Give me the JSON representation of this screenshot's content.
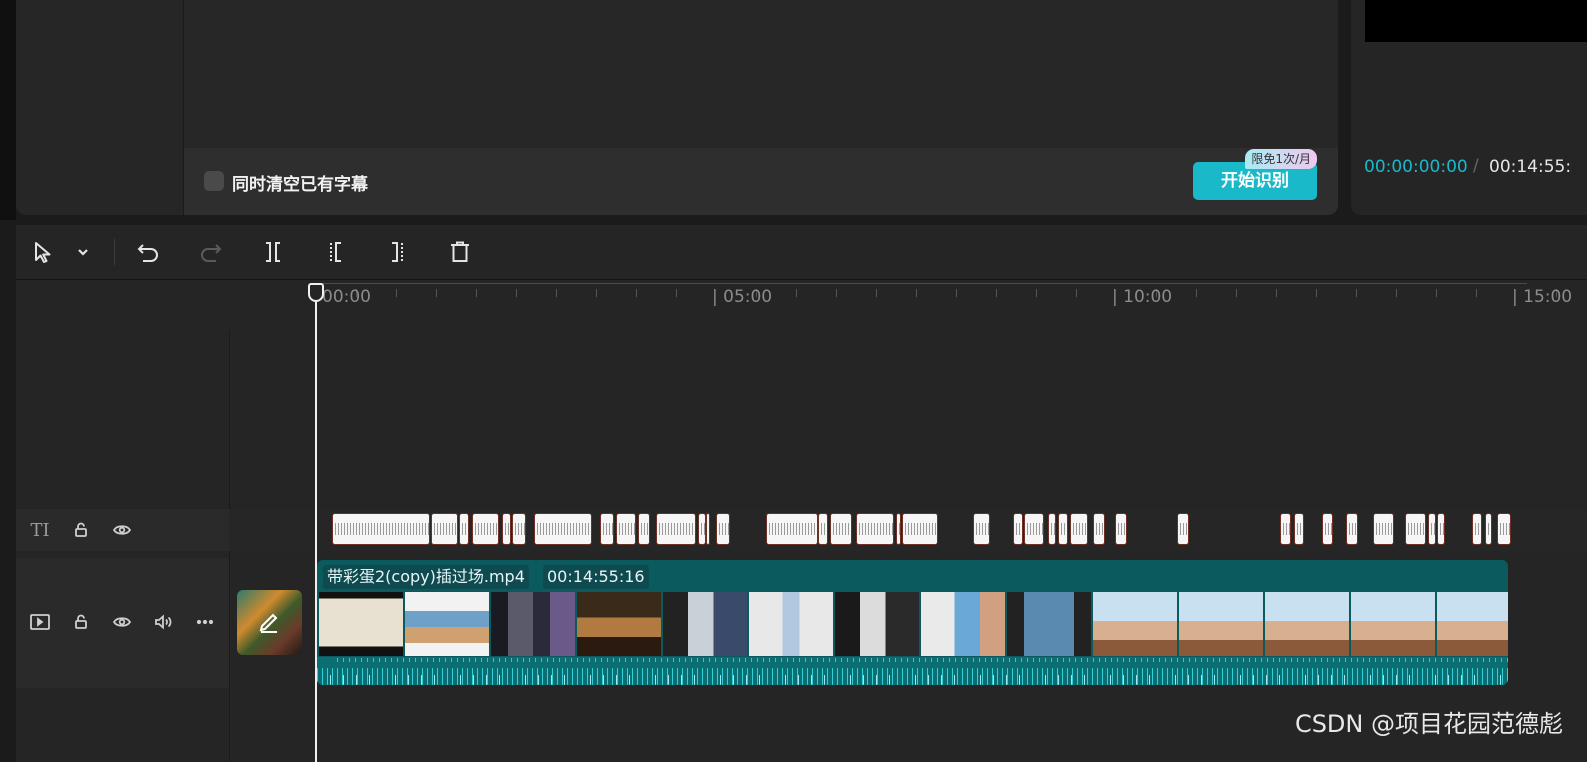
{
  "subtitle_panel": {
    "clear_checkbox_label": "同时清空已有字幕",
    "clear_checked": false,
    "start_button_label": "开始识别",
    "free_badge": "限免1次/月"
  },
  "player": {
    "current_time": "00:00:00:00",
    "separator": "/",
    "total_time": "00:14:55:"
  },
  "toolbar": {
    "icons": [
      "select-arrow-icon",
      "chevron-down-icon",
      "undo-icon",
      "redo-icon",
      "split-icon",
      "trim-left-icon",
      "trim-right-icon",
      "delete-icon"
    ],
    "redo_enabled": false
  },
  "ruler": {
    "labels": [
      "00:00",
      "| 05:00",
      "| 10:00",
      "| 15:00"
    ]
  },
  "tracks": {
    "text_track_icon_label": "TI",
    "video_clip": {
      "name": "带彩蛋2(copy)插过场.mp4",
      "duration": "00:14:55:16"
    }
  },
  "colors": {
    "accent": "#19b9c9",
    "clip_teal": "#0b5a5e",
    "subtitle_clip_border": "#6e3024"
  },
  "watermark": "CSDN @项目花园范德彪"
}
